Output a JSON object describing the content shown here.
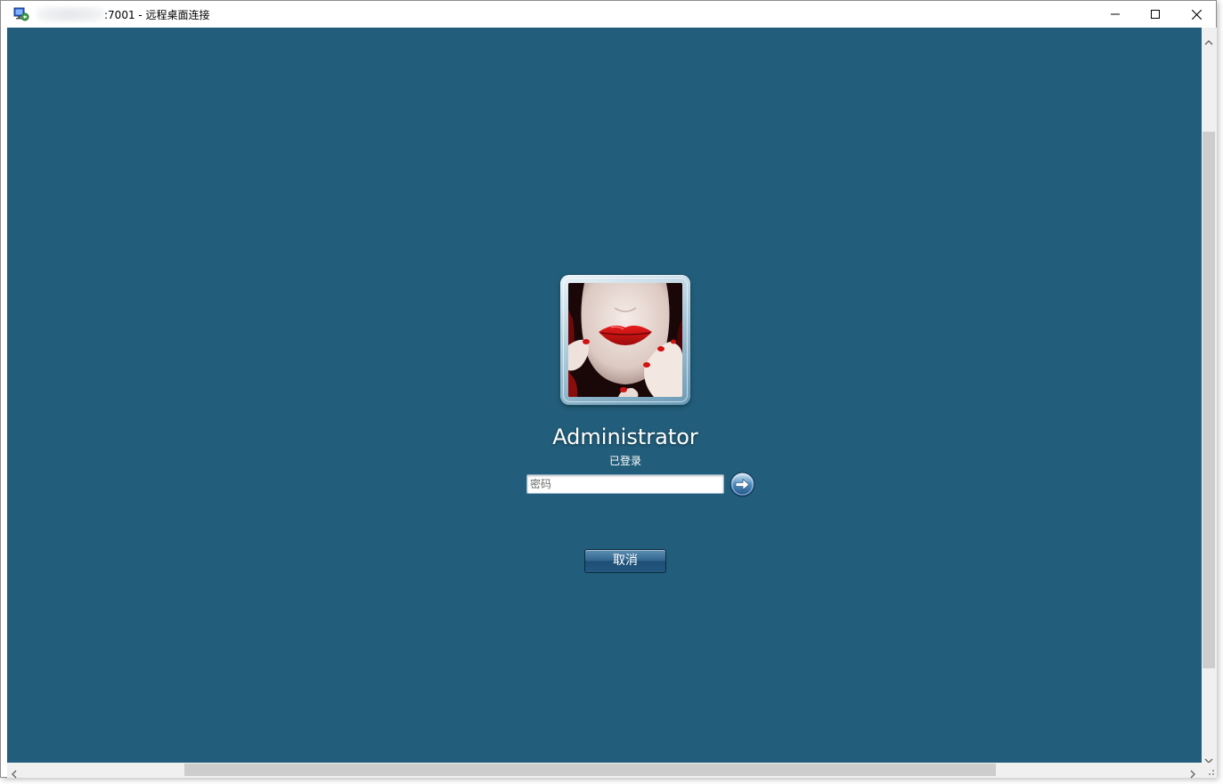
{
  "window": {
    "title": ":7001 - 远程桌面连接",
    "controls": {
      "minimize": "minimize-icon",
      "maximize": "maximize-icon",
      "close": "close-icon"
    }
  },
  "logon": {
    "user_name": "Administrator",
    "status": "已登录",
    "password_placeholder": "密码",
    "password_value": "",
    "submit_icon": "arrow-right-icon",
    "cancel_label": "取消"
  },
  "colors": {
    "desktop_background": "#225e7b",
    "button_blue": "#24587f",
    "scrollbar_track": "#f0f0f0",
    "scrollbar_thumb": "#cdcdcd"
  },
  "scrollbars": {
    "vertical_position": 0.14,
    "horizontal_position": 0.15
  }
}
